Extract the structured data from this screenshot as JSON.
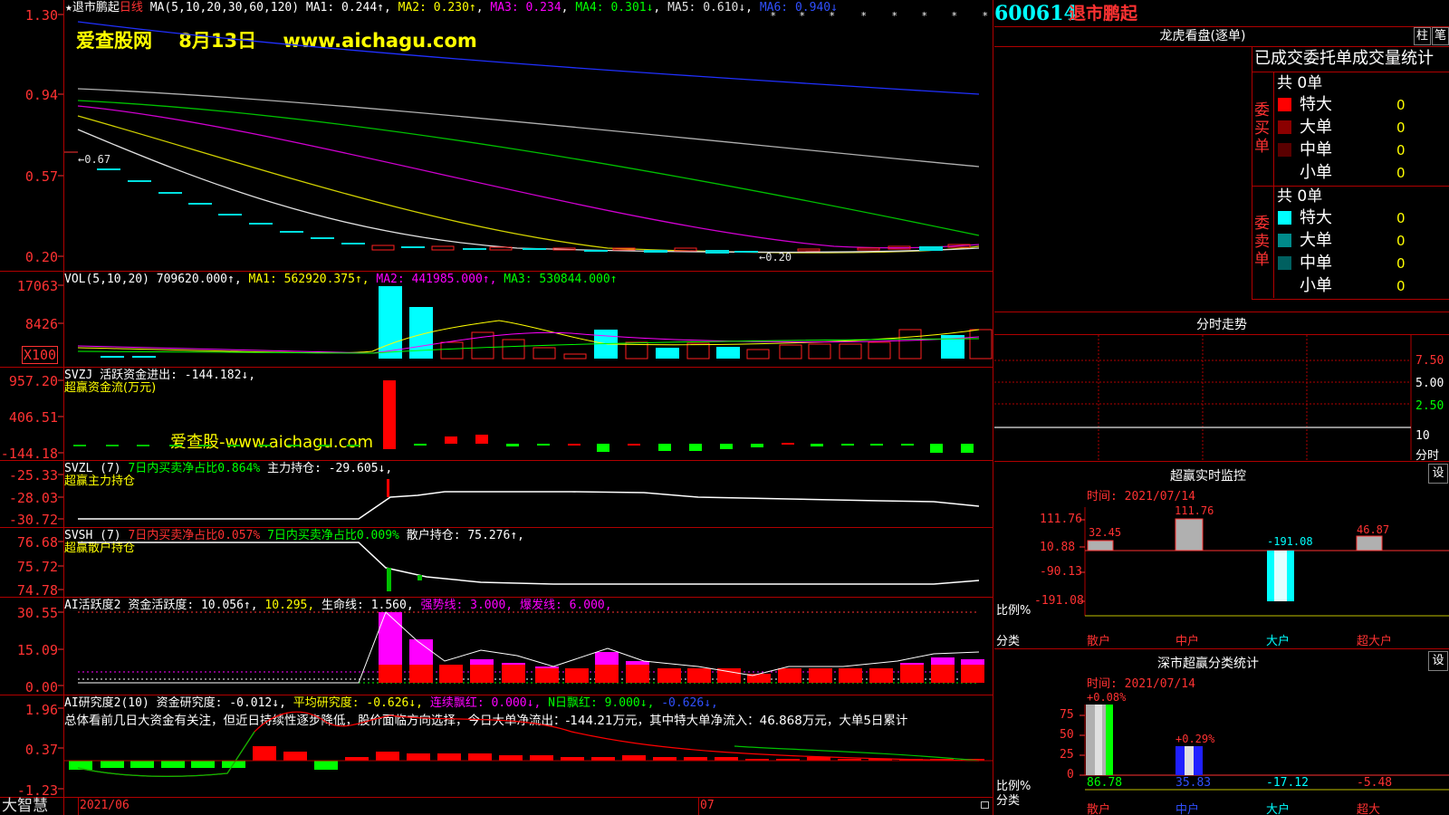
{
  "left": {
    "bottom_label": "大智慧",
    "date_start": "2021/06",
    "date_mid": "07",
    "p1": {
      "header_name": "退市鹏起",
      "header_period": "日线",
      "header_ma": "MA(5,10,20,30,60,120)",
      "ma1": "MA1: 0.244↑",
      "ma2": "MA2: 0.230↑",
      "ma3": "MA3: 0.234",
      "ma4": "MA4: 0.301↓",
      "ma5": "MA5: 0.610↓",
      "ma6": "MA6: 0.940↓",
      "watermark": "爱查股网    8月13日    www.aichagu.com",
      "ticks": [
        "1.30",
        "0.94",
        "0.57",
        "0.20"
      ],
      "high_label": "←0.67",
      "low_label": "←0.20"
    },
    "p2": {
      "header": "VOL(5,10,20)  709620.000↑,",
      "ma1": "MA1: 562920.375↑,",
      "ma2": "MA2: 441985.000↑,",
      "ma3": "MA3: 530844.000↑",
      "ticks": [
        "17063",
        "8426",
        "X100"
      ]
    },
    "p3": {
      "header": "SVZJ  活跃资金进出: -144.182↓,",
      "sub": "超赢资金流(万元)",
      "watermark": "爱查股-www.aichagu.com",
      "ticks": [
        "957.20",
        "406.51",
        "-144.18"
      ]
    },
    "p4": {
      "header_a": "SVZL (7)",
      "header_b": "7日内买卖净占比0.864%",
      "header_c": "主力持仓: -29.605↓,",
      "sub": "超赢主力持仓",
      "ticks": [
        "-25.33",
        "-28.03",
        "-30.72"
      ]
    },
    "p5": {
      "header_a": "SVSH (7)",
      "header_b": "7日内买卖净占比0.057%",
      "header_c": "7日内买卖净占比0.009%",
      "header_d": "散户持仓: 75.276↑,",
      "sub": "超赢散户持仓",
      "ticks": [
        "76.68",
        "75.72",
        "74.78"
      ]
    },
    "p6": {
      "header_a": "AI活跃度2",
      "header_b": "资金活跃度: 10.056↑,",
      "header_c": "10.295,",
      "header_d": "生命线: 1.560,",
      "header_e": "强势线: 3.000,",
      "header_f": "爆发线: 6.000,",
      "ticks": [
        "30.55",
        "15.09",
        "0.00"
      ]
    },
    "p7": {
      "header_a": "AI研究度2(10)",
      "header_b": "资金研究度: -0.012↓,",
      "header_c": "平均研究度: -0.626↓,",
      "header_d": "连续飘红: 0.000↓,",
      "header_e": "N日飘红: 9.000↓,",
      "header_f": "-0.626↓,",
      "comment": "总体看前几日大资金有关注，但近日持续性逐步降低，股价面临方向选择，今日大单净流出：-144.21万元，其中特大单净流入：46.868万元，大单5日累计",
      "ticks": [
        "1.96",
        "0.37",
        "-1.23"
      ]
    }
  },
  "right": {
    "code": "600614",
    "name": "退市鹏起",
    "longhu": {
      "title": "龙虎看盘(逐单)",
      "btn_a": "柱",
      "btn_b": "笔",
      "subtitle": "已成交委托单成交量统计",
      "buy_total": "共 0单",
      "buy_label": "委买单",
      "sell_total": "共 0单",
      "sell_label": "委卖单",
      "buy_rows": [
        {
          "label": "特大",
          "value": "0",
          "color": "#ff0000"
        },
        {
          "label": "大单",
          "value": "0",
          "color": "#8b0000"
        },
        {
          "label": "中单",
          "value": "0",
          "color": "#5a0000"
        },
        {
          "label": "小单",
          "value": "0",
          "color": ""
        }
      ],
      "sell_rows": [
        {
          "label": "特大",
          "value": "0",
          "color": "#00ffff"
        },
        {
          "label": "大单",
          "value": "0",
          "color": "#008b8b"
        },
        {
          "label": "中单",
          "value": "0",
          "color": "#006060"
        },
        {
          "label": "小单",
          "value": "0",
          "color": ""
        }
      ]
    },
    "fenshi": {
      "title": "分时走势",
      "ticks": [
        "7.50",
        "5.00",
        "2.50",
        "10"
      ],
      "foot": "分时"
    },
    "monitor": {
      "title": "超赢实时监控",
      "btn": "设",
      "time": "时间: 2021/07/14",
      "ticks": [
        "111.76",
        "10.88",
        "-90.13",
        "-191.08"
      ],
      "ratio_label": "比例%",
      "cat_label": "分类",
      "bars": [
        {
          "cat": "散户",
          "value": "32.45"
        },
        {
          "cat": "中户",
          "value": "111.76"
        },
        {
          "cat": "大户",
          "value": "-191.08"
        },
        {
          "cat": "超大户",
          "value": "46.87"
        }
      ]
    },
    "szstat": {
      "title": "深市超赢分类统计",
      "btn": "设",
      "time": "时间: 2021/07/14",
      "ticks": [
        "75",
        "50",
        "25",
        "0"
      ],
      "ratio_label": "比例%",
      "cat_label": "分类",
      "bars": [
        {
          "cat": "散户",
          "value": "86.78",
          "top": "+0.08%"
        },
        {
          "cat": "中户",
          "value": "35.83",
          "top": "+0.29%"
        },
        {
          "cat": "大户",
          "value": "-17.12",
          "top": ""
        },
        {
          "cat": "超大",
          "value": "-5.48",
          "top": ""
        }
      ]
    }
  }
}
